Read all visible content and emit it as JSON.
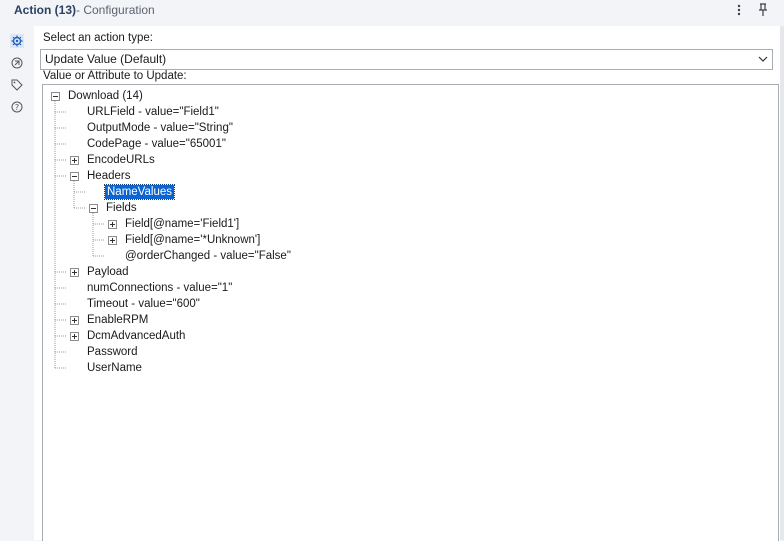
{
  "header": {
    "title": "Action (13)",
    "subtitle": "- Configuration",
    "menu_icon": "more-vertical-icon",
    "pin_icon": "pin-icon"
  },
  "sidebar": {
    "icons": [
      "gear-icon",
      "connector-icon",
      "tag-icon",
      "help-icon"
    ]
  },
  "action_type": {
    "label": "Select an action type:",
    "selected": "Update Value (Default)"
  },
  "tree": {
    "label": "Value or Attribute to Update:",
    "nodes": [
      {
        "text": "Download (14)",
        "expander": "minus"
      },
      {
        "text": "URLField - value=\"Field1\"",
        "expander": "none"
      },
      {
        "text": "OutputMode - value=\"String\"",
        "expander": "none"
      },
      {
        "text": "CodePage - value=\"65001\"",
        "expander": "none"
      },
      {
        "text": "EncodeURLs",
        "expander": "plus"
      },
      {
        "text": "Headers",
        "expander": "minus"
      },
      {
        "text": "NameValues",
        "expander": "none",
        "selected": true
      },
      {
        "text": "Fields",
        "expander": "minus"
      },
      {
        "text": "Field[@name='Field1']",
        "expander": "plus"
      },
      {
        "text": "Field[@name='*Unknown']",
        "expander": "plus"
      },
      {
        "text": "@orderChanged - value=\"False\"",
        "expander": "none"
      },
      {
        "text": "Payload",
        "expander": "plus"
      },
      {
        "text": "numConnections - value=\"1\"",
        "expander": "none"
      },
      {
        "text": "Timeout - value=\"600\"",
        "expander": "none"
      },
      {
        "text": "EnableRPM",
        "expander": "plus"
      },
      {
        "text": "DcmAdvancedAuth",
        "expander": "plus"
      },
      {
        "text": "Password",
        "expander": "none"
      },
      {
        "text": "UserName",
        "expander": "none"
      }
    ]
  },
  "colors": {
    "accent": "#0a64d4",
    "title": "#2b3f63",
    "border": "#a8acb3"
  }
}
